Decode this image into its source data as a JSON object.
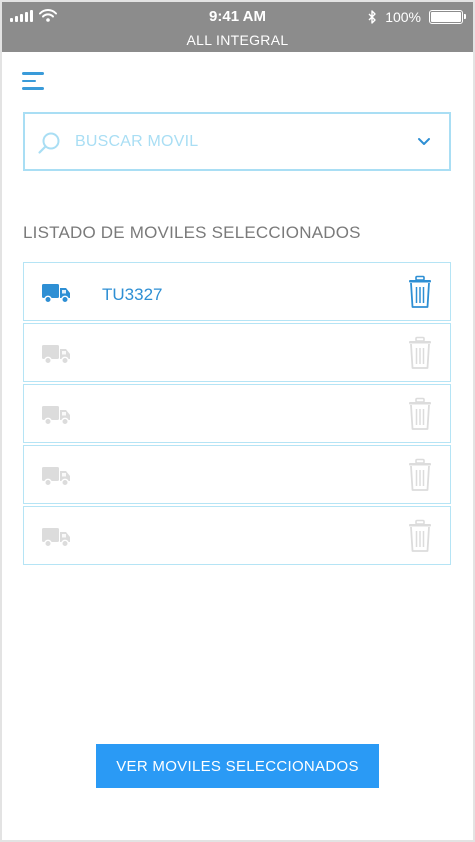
{
  "status_bar": {
    "time": "9:41 AM",
    "title": "ALL INTEGRAL",
    "battery": "100%",
    "icons": [
      "signal-icon",
      "wifi-icon",
      "bluetooth-icon",
      "battery-icon"
    ]
  },
  "header": {
    "menu_icon": "hamburger-menu-icon"
  },
  "search": {
    "placeholder": "BUSCAR MOVIL",
    "icons": [
      "search-icon",
      "chevron-down-icon"
    ]
  },
  "list": {
    "heading": "LISTADO DE MOVILES SELECCIONADOS",
    "rows": [
      {
        "plate": "TU3327",
        "active": true
      },
      {
        "plate": "",
        "active": false
      },
      {
        "plate": "",
        "active": false
      },
      {
        "plate": "",
        "active": false
      },
      {
        "plate": "",
        "active": false
      }
    ]
  },
  "actions": {
    "view_selected": "VER MOVILES SELECCIONADOS"
  },
  "colors": {
    "accent": "#2a9af5",
    "active_icon": "#2e8fd4",
    "inactive_icon": "#dcdcdc",
    "border": "#a9def4",
    "status_bar": "#8c8c8c"
  }
}
